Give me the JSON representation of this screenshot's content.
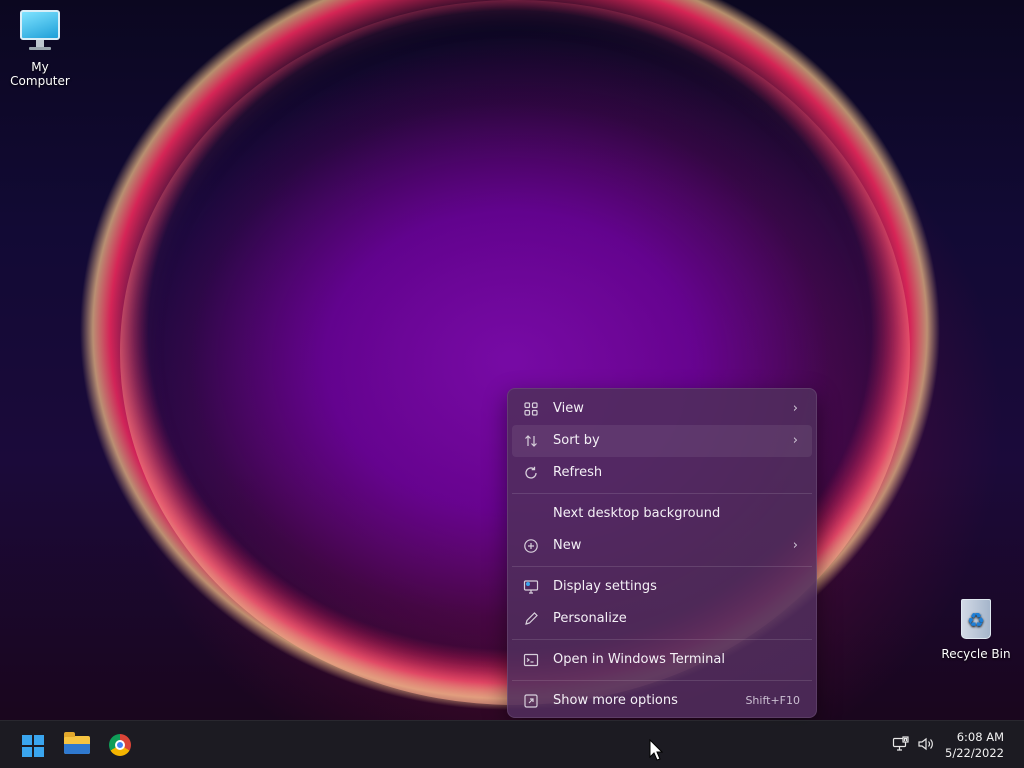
{
  "desktop": {
    "icons": [
      {
        "label": "My Computer",
        "icon": "monitor-icon"
      },
      {
        "label": "Recycle Bin",
        "icon": "recycle-bin-icon"
      }
    ]
  },
  "context_menu": {
    "items": [
      {
        "label": "View",
        "icon": "grid-icon",
        "submenu": true
      },
      {
        "label": "Sort by",
        "icon": "sort-icon",
        "submenu": true
      },
      {
        "label": "Refresh",
        "icon": "refresh-icon"
      },
      {
        "label": "Next desktop background",
        "icon": ""
      },
      {
        "label": "New",
        "icon": "plus-circle-icon",
        "submenu": true
      },
      {
        "label": "Display settings",
        "icon": "display-settings-icon"
      },
      {
        "label": "Personalize",
        "icon": "pen-icon"
      },
      {
        "label": "Open in Windows Terminal",
        "icon": "terminal-icon"
      },
      {
        "label": "Show more options",
        "icon": "more-options-icon",
        "shortcut": "Shift+F10"
      }
    ],
    "highlighted": "Sort by",
    "submenu_arrow": "›"
  },
  "taskbar": {
    "pinned": [
      {
        "name": "Start",
        "icon": "windows-start-icon"
      },
      {
        "name": "File Explorer",
        "icon": "file-explorer-icon"
      },
      {
        "name": "Google Chrome",
        "icon": "chrome-icon"
      }
    ],
    "tray": {
      "network_icon": "network-icon",
      "volume_icon": "volume-icon",
      "time": "6:08 AM",
      "date": "5/22/2022"
    }
  },
  "colors": {
    "accent": "#3aa5ee",
    "menu_bg": "#502e5c",
    "taskbar_bg": "#1c1c22"
  }
}
